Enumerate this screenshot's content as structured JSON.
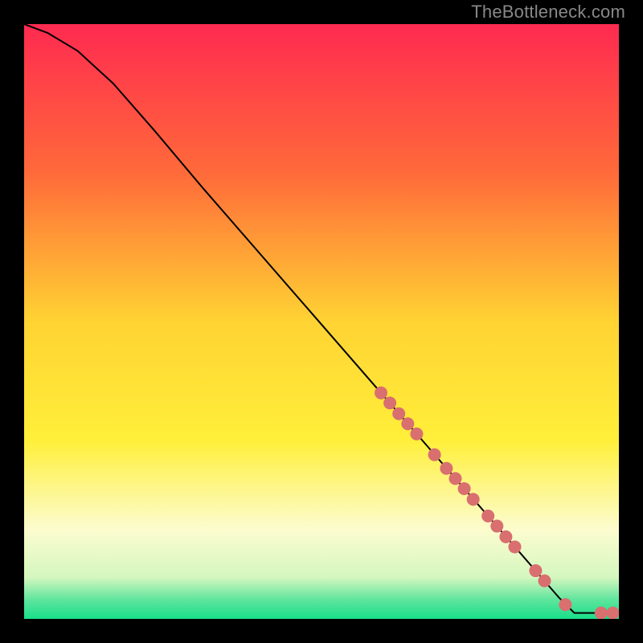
{
  "watermark": "TheBottleneck.com",
  "chart_data": {
    "type": "line",
    "title": "",
    "xlabel": "",
    "ylabel": "",
    "xlim": [
      0,
      100
    ],
    "ylim": [
      0,
      100
    ],
    "background": {
      "type": "vertical-gradient",
      "stops": [
        {
          "offset": 0.0,
          "color": "#ff2a50"
        },
        {
          "offset": 0.25,
          "color": "#ff6a3a"
        },
        {
          "offset": 0.5,
          "color": "#ffd333"
        },
        {
          "offset": 0.7,
          "color": "#ffef3a"
        },
        {
          "offset": 0.85,
          "color": "#fcfccf"
        },
        {
          "offset": 0.93,
          "color": "#d5f7bf"
        },
        {
          "offset": 0.97,
          "color": "#59e49c"
        },
        {
          "offset": 1.0,
          "color": "#19df8a"
        }
      ]
    },
    "series": [
      {
        "name": "curve",
        "stroke": "#000000",
        "points": [
          {
            "x": 0.0,
            "y": 100.0
          },
          {
            "x": 4.0,
            "y": 98.5
          },
          {
            "x": 9.0,
            "y": 95.5
          },
          {
            "x": 15.0,
            "y": 90.0
          },
          {
            "x": 22.0,
            "y": 82.0
          },
          {
            "x": 30.0,
            "y": 72.5
          },
          {
            "x": 40.0,
            "y": 61.0
          },
          {
            "x": 50.0,
            "y": 49.5
          },
          {
            "x": 60.0,
            "y": 38.0
          },
          {
            "x": 70.0,
            "y": 26.5
          },
          {
            "x": 80.0,
            "y": 15.0
          },
          {
            "x": 90.0,
            "y": 3.5
          },
          {
            "x": 92.5,
            "y": 1.0
          },
          {
            "x": 96.0,
            "y": 1.0
          },
          {
            "x": 100.0,
            "y": 1.0
          }
        ]
      }
    ],
    "markers": {
      "color": "#d96f6f",
      "radius_small": 6,
      "radius_large": 8,
      "points": [
        {
          "x": 60.0,
          "y": 38.0
        },
        {
          "x": 61.5,
          "y": 36.3
        },
        {
          "x": 63.0,
          "y": 34.5
        },
        {
          "x": 64.5,
          "y": 32.8
        },
        {
          "x": 66.0,
          "y": 31.1
        },
        {
          "x": 69.0,
          "y": 27.6
        },
        {
          "x": 71.0,
          "y": 25.3
        },
        {
          "x": 72.5,
          "y": 23.6
        },
        {
          "x": 74.0,
          "y": 21.9
        },
        {
          "x": 75.5,
          "y": 20.1
        },
        {
          "x": 78.0,
          "y": 17.3
        },
        {
          "x": 79.5,
          "y": 15.6
        },
        {
          "x": 81.0,
          "y": 13.8
        },
        {
          "x": 82.5,
          "y": 12.1
        },
        {
          "x": 86.0,
          "y": 8.1
        },
        {
          "x": 87.5,
          "y": 6.4
        },
        {
          "x": 91.0,
          "y": 2.4
        },
        {
          "x": 97.0,
          "y": 1.0
        },
        {
          "x": 99.0,
          "y": 1.0
        }
      ]
    }
  }
}
